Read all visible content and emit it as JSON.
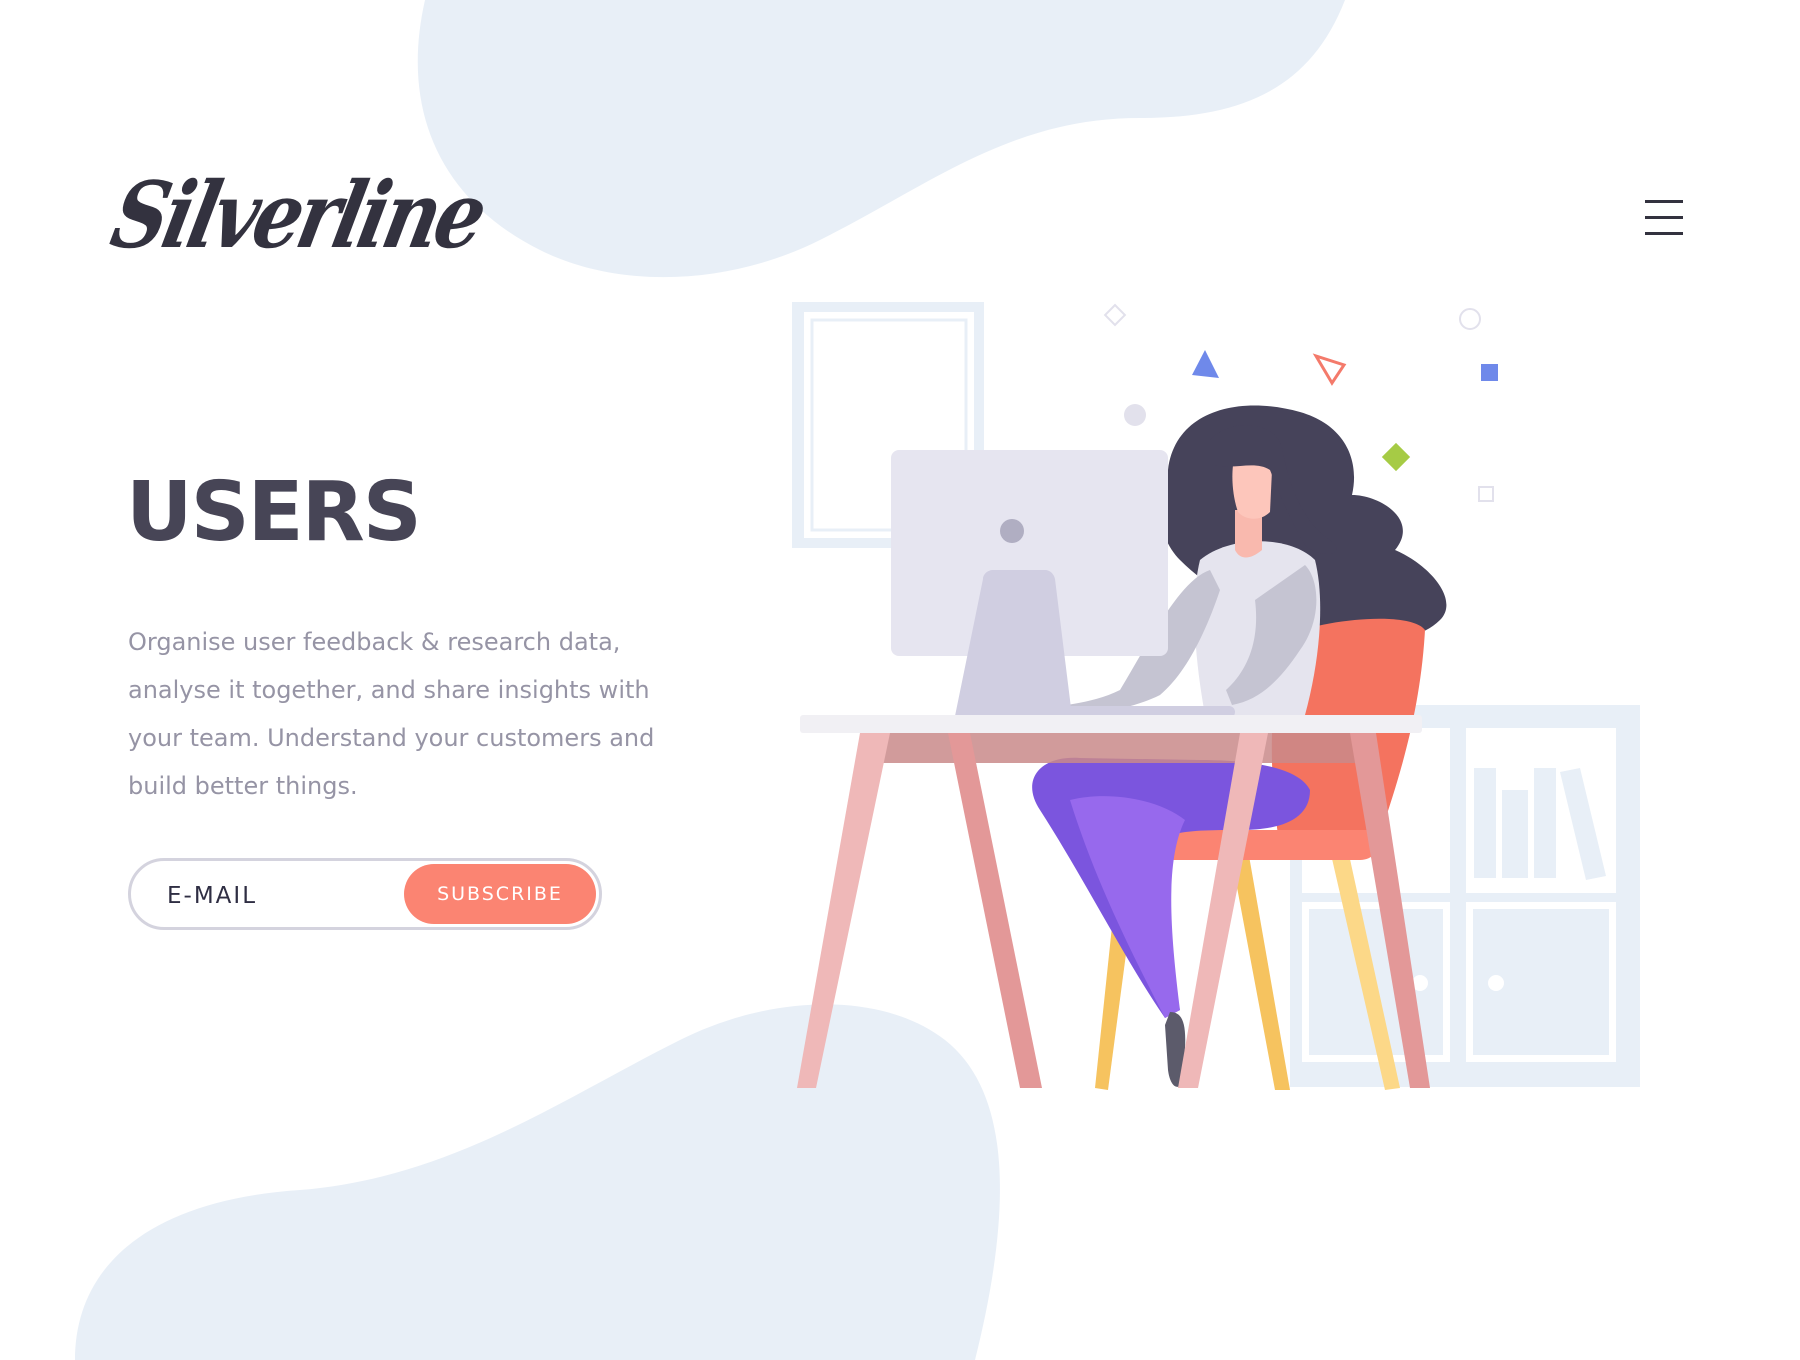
{
  "header": {
    "logo_text": "Silverline",
    "menu_icon": "hamburger-menu-icon"
  },
  "hero": {
    "title": "USERS",
    "description": "Organise user feedback & research data, analyse it together, and share insights with your team. Understand your customers and build better things."
  },
  "subscribe": {
    "email_placeholder": "E-MAIL",
    "button_label": "SUBSCRIBE"
  },
  "illustration": {
    "subject": "woman-at-desk-with-computer-illustration",
    "icons": [
      "diamond-icon",
      "circle-icon",
      "triangle-icon",
      "square-icon"
    ]
  },
  "colors": {
    "background": "#ffffff",
    "blob": "#e8eff7",
    "heading": "#474556",
    "body_text": "#9694a5",
    "accent": "#fb8472",
    "hair": "#46435a",
    "pants": "#7b55de",
    "chair": "#f4735f",
    "desk": "#e8a0a0",
    "monitor": "#e6e5f0"
  }
}
